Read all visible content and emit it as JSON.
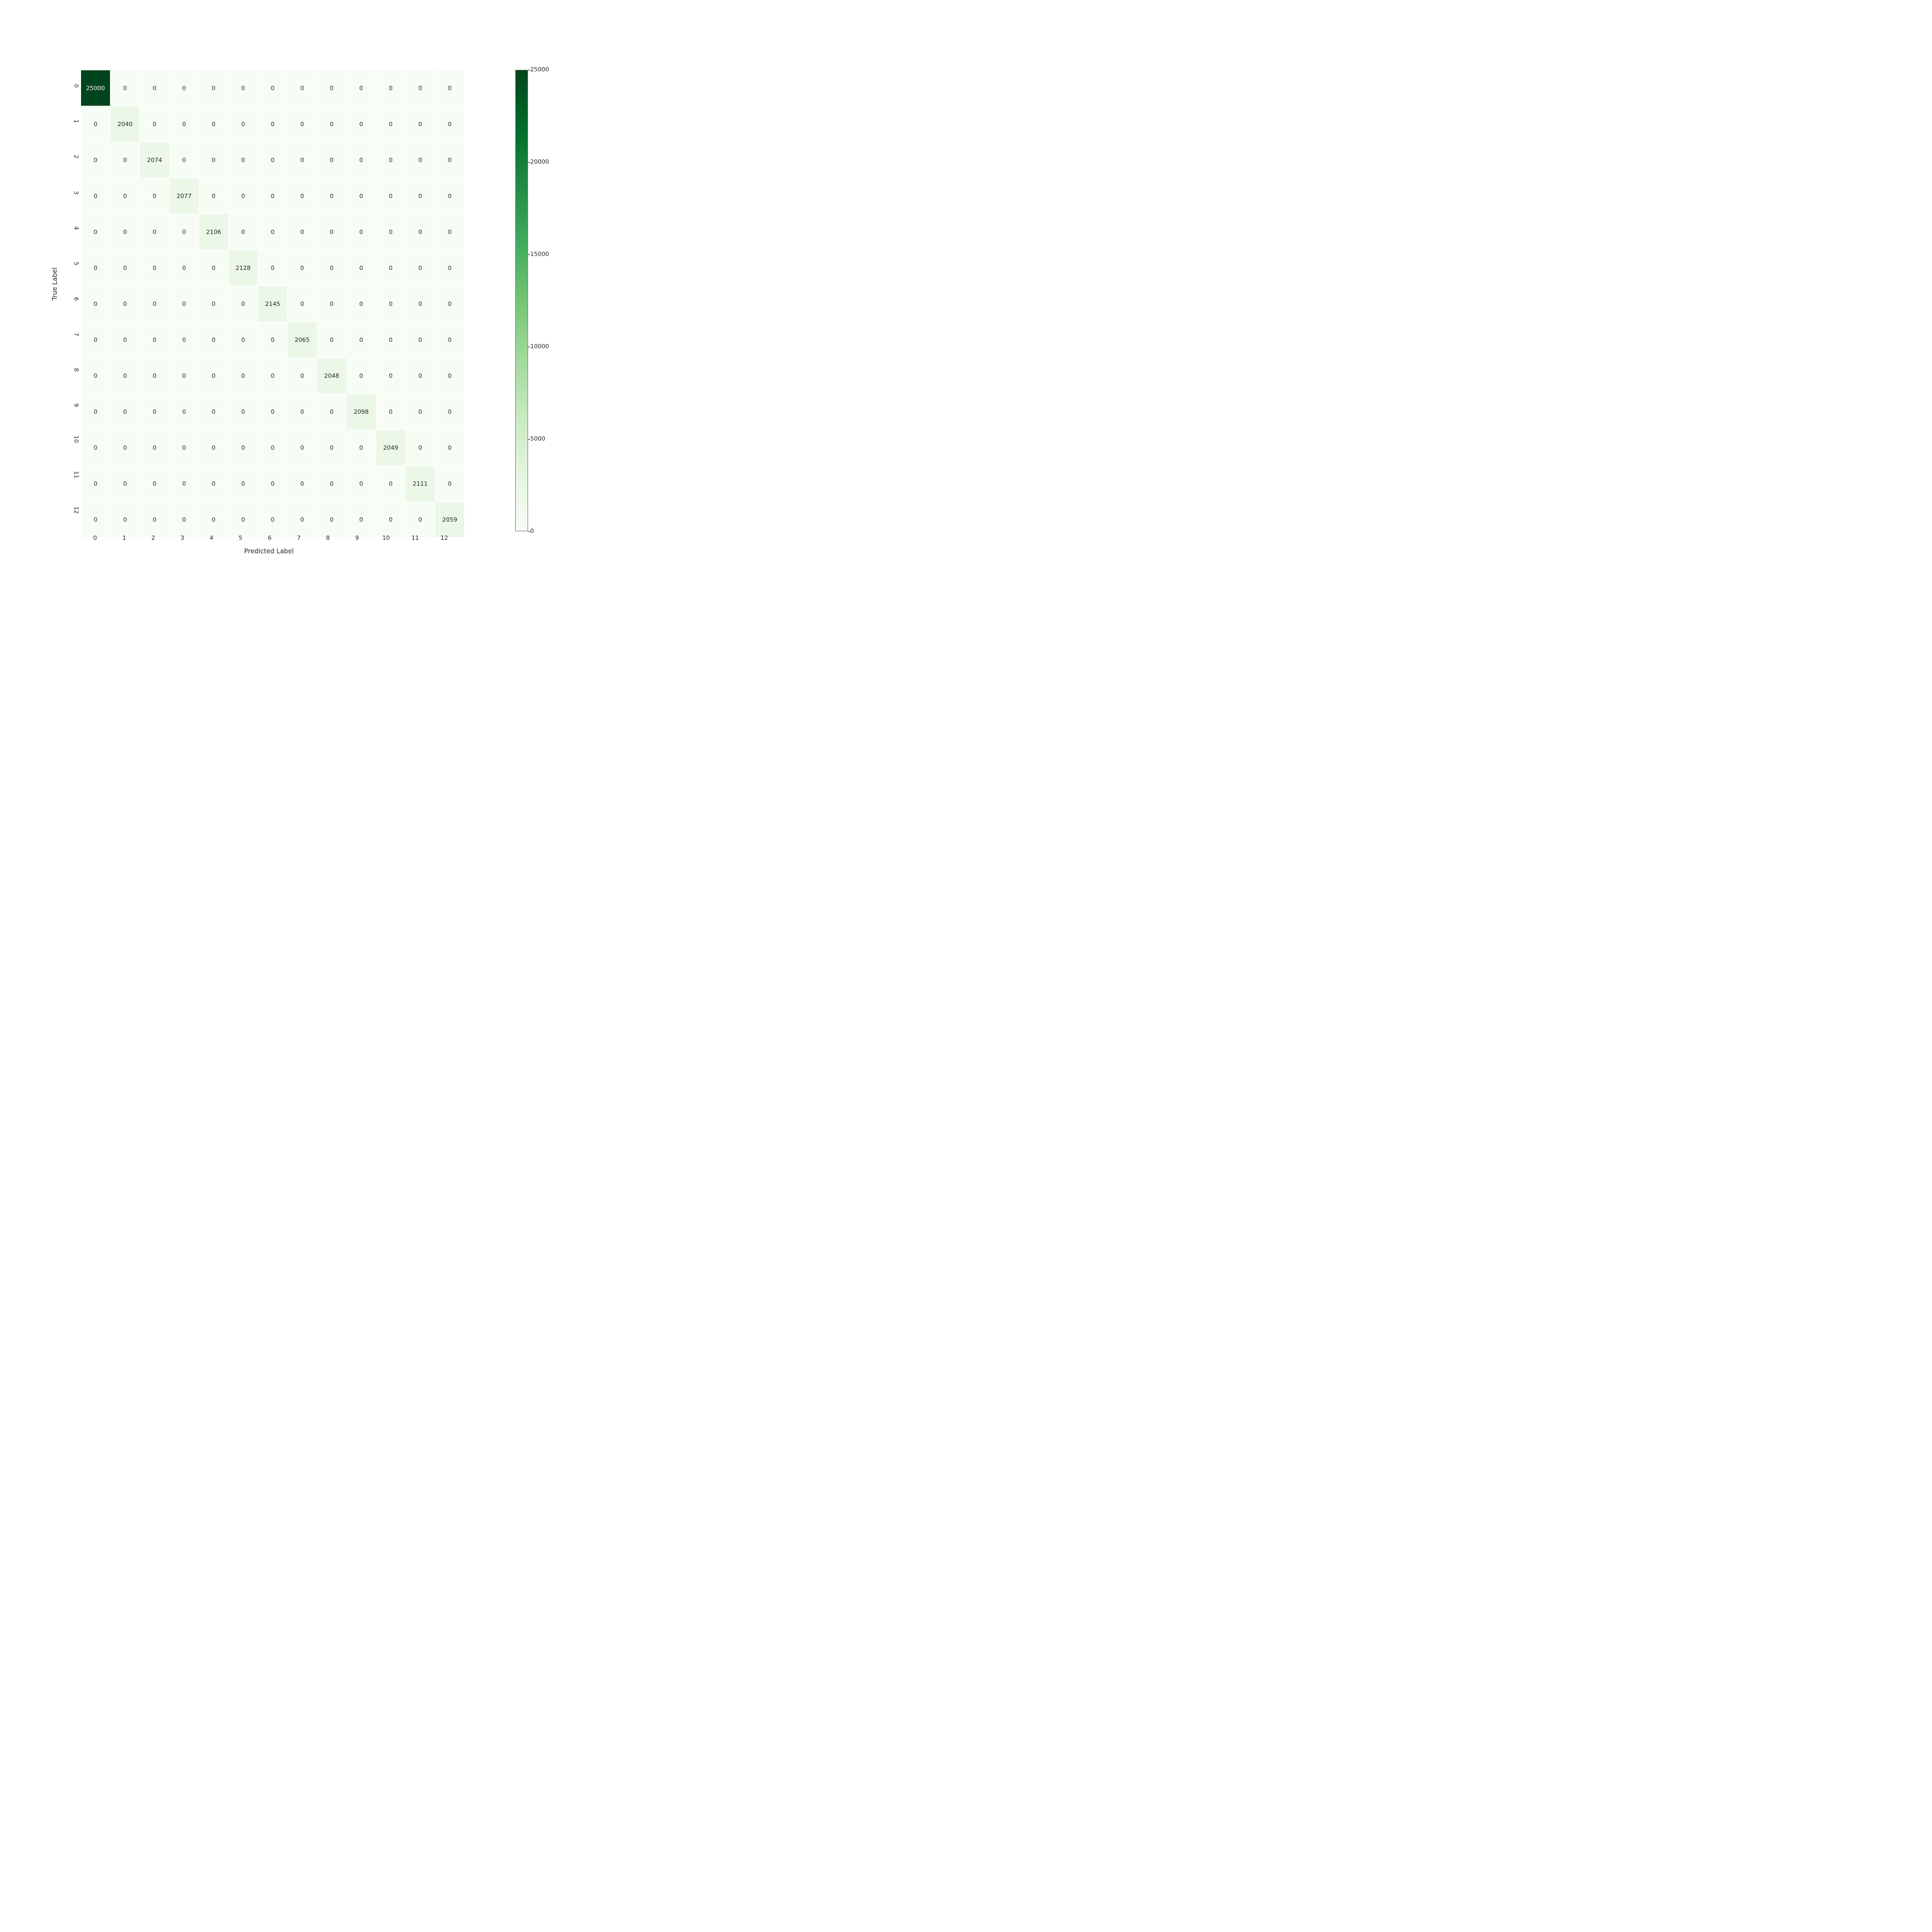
{
  "chart_data": {
    "type": "heatmap",
    "title": "",
    "xlabel": "Predicted Label",
    "ylabel": "True Label",
    "x_categories": [
      "0",
      "1",
      "2",
      "3",
      "4",
      "5",
      "6",
      "7",
      "8",
      "9",
      "10",
      "11",
      "12"
    ],
    "y_categories": [
      "0",
      "1",
      "2",
      "3",
      "4",
      "5",
      "6",
      "7",
      "8",
      "9",
      "10",
      "11",
      "12"
    ],
    "values": [
      [
        25000,
        0,
        0,
        0,
        0,
        0,
        0,
        0,
        0,
        0,
        0,
        0,
        0
      ],
      [
        0,
        2040,
        0,
        0,
        0,
        0,
        0,
        0,
        0,
        0,
        0,
        0,
        0
      ],
      [
        0,
        0,
        2074,
        0,
        0,
        0,
        0,
        0,
        0,
        0,
        0,
        0,
        0
      ],
      [
        0,
        0,
        0,
        2077,
        0,
        0,
        0,
        0,
        0,
        0,
        0,
        0,
        0
      ],
      [
        0,
        0,
        0,
        0,
        2106,
        0,
        0,
        0,
        0,
        0,
        0,
        0,
        0
      ],
      [
        0,
        0,
        0,
        0,
        0,
        2128,
        0,
        0,
        0,
        0,
        0,
        0,
        0
      ],
      [
        0,
        0,
        0,
        0,
        0,
        0,
        2145,
        0,
        0,
        0,
        0,
        0,
        0
      ],
      [
        0,
        0,
        0,
        0,
        0,
        0,
        0,
        2065,
        0,
        0,
        0,
        0,
        0
      ],
      [
        0,
        0,
        0,
        0,
        0,
        0,
        0,
        0,
        2048,
        0,
        0,
        0,
        0
      ],
      [
        0,
        0,
        0,
        0,
        0,
        0,
        0,
        0,
        0,
        2098,
        0,
        0,
        0
      ],
      [
        0,
        0,
        0,
        0,
        0,
        0,
        0,
        0,
        0,
        0,
        2049,
        0,
        0
      ],
      [
        0,
        0,
        0,
        0,
        0,
        0,
        0,
        0,
        0,
        0,
        0,
        2111,
        0
      ],
      [
        0,
        0,
        0,
        0,
        0,
        0,
        0,
        0,
        0,
        0,
        0,
        0,
        2059
      ]
    ],
    "vmin": 0,
    "vmax": 25000,
    "colormap": "Greens",
    "colorbar_ticks": [
      0,
      5000,
      10000,
      15000,
      20000,
      25000
    ]
  }
}
